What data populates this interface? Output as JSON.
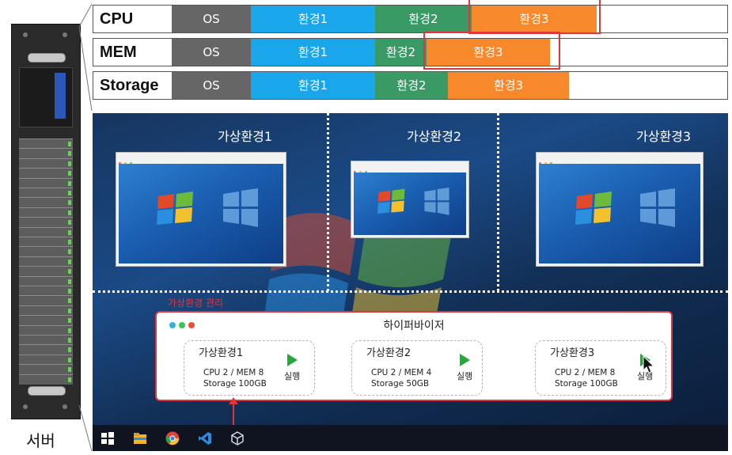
{
  "resources": [
    {
      "label": "CPU",
      "segments": [
        {
          "label": "OS",
          "kind": "os",
          "start": 0,
          "end": 100
        },
        {
          "label": "환경1",
          "kind": "e1",
          "start": 100,
          "end": 257
        },
        {
          "label": "환경2",
          "kind": "e2",
          "start": 257,
          "end": 379
        },
        {
          "label": "환경3",
          "kind": "e3",
          "start": 379,
          "end": 537
        }
      ]
    },
    {
      "label": "MEM",
      "segments": [
        {
          "label": "OS",
          "kind": "os",
          "start": 0,
          "end": 100
        },
        {
          "label": "환경1",
          "kind": "e1",
          "start": 100,
          "end": 257
        },
        {
          "label": "환경2",
          "kind": "e2",
          "start": 257,
          "end": 322
        },
        {
          "label": "환경3",
          "kind": "e3",
          "start": 322,
          "end": 478
        }
      ]
    },
    {
      "label": "Storage",
      "segments": [
        {
          "label": "OS",
          "kind": "os",
          "start": 0,
          "end": 100
        },
        {
          "label": "환경1",
          "kind": "e1",
          "start": 100,
          "end": 257
        },
        {
          "label": "환경2",
          "kind": "e2",
          "start": 257,
          "end": 349
        },
        {
          "label": "환경3",
          "kind": "e3",
          "start": 349,
          "end": 502
        }
      ]
    }
  ],
  "colors": {
    "os": "#666666",
    "e1": "#1aa6ea",
    "e2": "#3a9a66",
    "e3": "#f7882b",
    "highlight": "#e0353b",
    "play": "#22aa3a"
  },
  "desktop": {
    "vm_labels": [
      "가상환경1",
      "가상환경2",
      "가상환경3"
    ]
  },
  "manager_label": "가상환경 관리",
  "hypervisor": {
    "title": "하이퍼바이저",
    "vms": [
      {
        "name": "가상환경1",
        "spec": "CPU 2 / MEM 8\nStorage 100GB",
        "run_label": "실행"
      },
      {
        "name": "가상환경2",
        "spec": "CPU 2 / MEM 4\nStorage 50GB",
        "run_label": "실행"
      },
      {
        "name": "가상환경3",
        "spec": "CPU 2 / MEM 8\nStorage 100GB",
        "run_label": "실행"
      }
    ]
  },
  "taskbar_icons": [
    "windows-start-icon",
    "file-explorer-icon",
    "chrome-icon",
    "vscode-icon",
    "virtualbox-icon"
  ],
  "caption": "서버"
}
